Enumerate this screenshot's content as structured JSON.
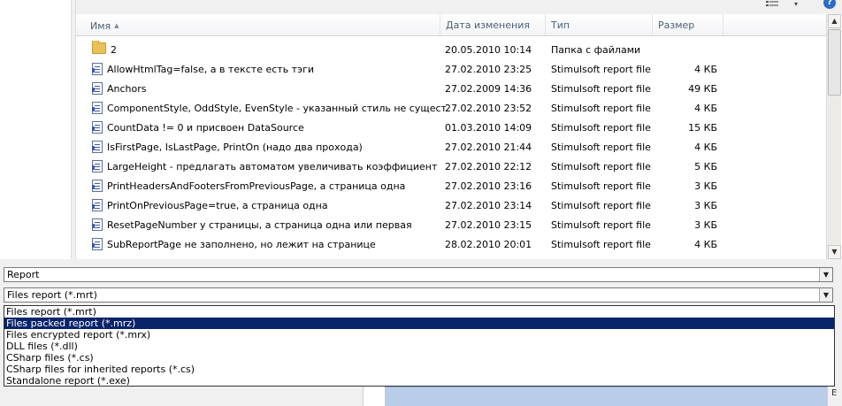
{
  "toolbar": {
    "view_icon": "view-menu-icon",
    "view_arrow": "▾",
    "help": "?"
  },
  "columns": {
    "name": "Имя",
    "sort_indicator": "▲",
    "date": "Дата изменения",
    "type": "Тип",
    "size": "Размер"
  },
  "files": [
    {
      "name": "2",
      "date": "20.05.2010 10:14",
      "type": "Папка с файлами",
      "size": "",
      "icon": "folder-icon"
    },
    {
      "name": "AllowHtmlTag=false, а в тексте есть тэги",
      "date": "27.02.2010 23:25",
      "type": "Stimulsoft report file",
      "size": "4 КБ",
      "icon": "report-file-icon"
    },
    {
      "name": "Anchors",
      "date": "27.02.2009 14:36",
      "type": "Stimulsoft report file",
      "size": "49 КБ",
      "icon": "report-file-icon"
    },
    {
      "name": "ComponentStyle, OddStyle, EvenStyle - указанный стиль не существует",
      "date": "27.02.2010 23:52",
      "type": "Stimulsoft report file",
      "size": "4 КБ",
      "icon": "report-file-icon"
    },
    {
      "name": "CountData != 0 и присвоен DataSource",
      "date": "01.03.2010 14:09",
      "type": "Stimulsoft report file",
      "size": "15 КБ",
      "icon": "report-file-icon"
    },
    {
      "name": "IsFirstPage, IsLastPage, PrintOn (надо два прохода)",
      "date": "27.02.2010 21:44",
      "type": "Stimulsoft report file",
      "size": "4 КБ",
      "icon": "report-file-icon"
    },
    {
      "name": "LargeHeight - предлагать автоматом увеличивать коэффициент",
      "date": "27.02.2010 22:12",
      "type": "Stimulsoft report file",
      "size": "5 КБ",
      "icon": "report-file-icon"
    },
    {
      "name": "PrintHeadersAndFootersFromPreviousPage, а страница одна",
      "date": "27.02.2010 23:16",
      "type": "Stimulsoft report file",
      "size": "3 КБ",
      "icon": "report-file-icon"
    },
    {
      "name": "PrintOnPreviousPage=true, а страница одна",
      "date": "27.02.2010 23:14",
      "type": "Stimulsoft report file",
      "size": "3 КБ",
      "icon": "report-file-icon"
    },
    {
      "name": "ResetPageNumber у страницы, а страница одна или первая",
      "date": "27.02.2010 23:15",
      "type": "Stimulsoft report file",
      "size": "3 КБ",
      "icon": "report-file-icon"
    },
    {
      "name": "SubReportPage не заполнено, но лежит на странице",
      "date": "28.02.2010 20:01",
      "type": "Stimulsoft report file",
      "size": "4 КБ",
      "icon": "report-file-icon"
    }
  ],
  "scrollbar": {
    "up": "▲",
    "down": "▼"
  },
  "filename_combo": {
    "value": "Report",
    "arrow": "▼"
  },
  "filter_combo": {
    "value": "Files report (*.mrt)",
    "arrow": "▼"
  },
  "filter_options": [
    {
      "label": "Files report (*.mrt)",
      "selected": false
    },
    {
      "label": "Files packed report (*.mrz)",
      "selected": true
    },
    {
      "label": "Files encrypted report (*.mrx)",
      "selected": false
    },
    {
      "label": "DLL files (*.dll)",
      "selected": false
    },
    {
      "label": "CSharp files (*.cs)",
      "selected": false
    },
    {
      "label": "CSharp files for inherited reports (*.cs)",
      "selected": false
    },
    {
      "label": "Standalone report (*.exe)",
      "selected": false
    }
  ],
  "lower_right_glyph": "E",
  "colors": {
    "selection": "#0a246a",
    "header_text": "#4c607a",
    "folder": "#e8c15a",
    "report_icon": "#3b56a6"
  }
}
